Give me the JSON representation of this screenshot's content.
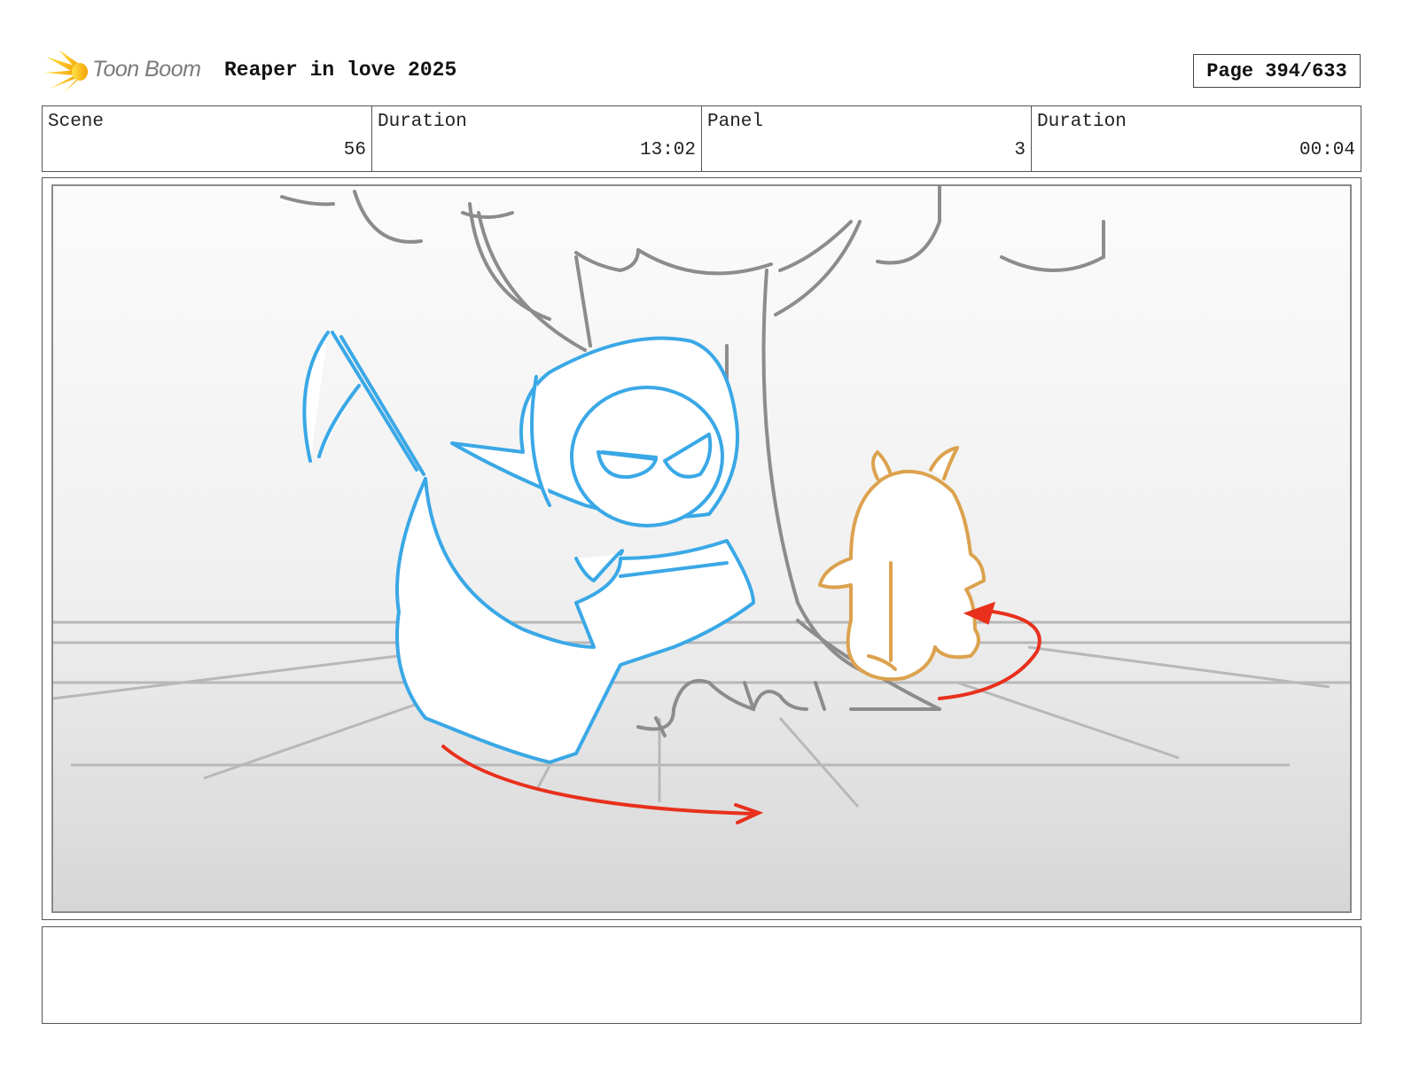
{
  "header": {
    "logo_text": "Toon Boom",
    "project_title": "Reaper in love 2025",
    "page_label": "Page 394/633"
  },
  "info": {
    "scene_label": "Scene",
    "scene_value": "56",
    "scene_duration_label": "Duration",
    "scene_duration_value": "13:02",
    "panel_label": "Panel",
    "panel_value": "3",
    "panel_duration_label": "Duration",
    "panel_duration_value": "00:04"
  },
  "colors": {
    "reaper": "#3aa8e6",
    "creature": "#dca24e",
    "arrow": "#e8301c",
    "tree": "#8c8c8c",
    "logo_yellow": "#f6c400"
  },
  "notes": {
    "text": ""
  }
}
